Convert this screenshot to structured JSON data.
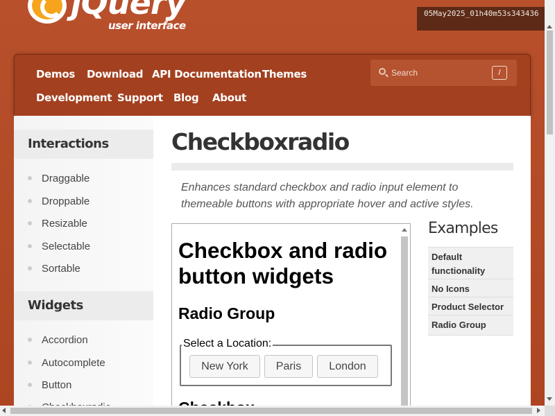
{
  "brand": {
    "logo_text": "jQuery",
    "logo_subtitle": "user interface"
  },
  "timestamp": "05May2025_01h40m53s343436",
  "nav": {
    "row1": [
      "Demos",
      "Download",
      "API Documentation",
      "Themes"
    ],
    "row2": [
      "Development",
      "Support",
      "Blog",
      "About"
    ],
    "search": {
      "placeholder": "Search",
      "shortcut": "/"
    }
  },
  "sidebar": {
    "interactions_heading": "Interactions",
    "interactions": [
      "Draggable",
      "Droppable",
      "Resizable",
      "Selectable",
      "Sortable"
    ],
    "widgets_heading": "Widgets",
    "widgets": [
      "Accordion",
      "Autocomplete",
      "Button",
      "Checkboxradio"
    ]
  },
  "main": {
    "title": "Checkboxradio",
    "description": "Enhances standard checkbox and radio input element to themeable buttons with appropriate hover and active styles."
  },
  "demo": {
    "heading": "Checkbox and radio button widgets",
    "radio_group_heading": "Radio Group",
    "legend": "Select a Location:",
    "options": [
      "New York",
      "Paris",
      "London"
    ],
    "next_heading": "Checkbox"
  },
  "examples": {
    "heading": "Examples",
    "items": [
      "Default functionality",
      "No Icons",
      "Product Selector",
      "Radio Group"
    ]
  },
  "colors": {
    "brand_background": "#b24926",
    "nav_background": "#a3401f",
    "logo_accent": "#f7a41c"
  }
}
